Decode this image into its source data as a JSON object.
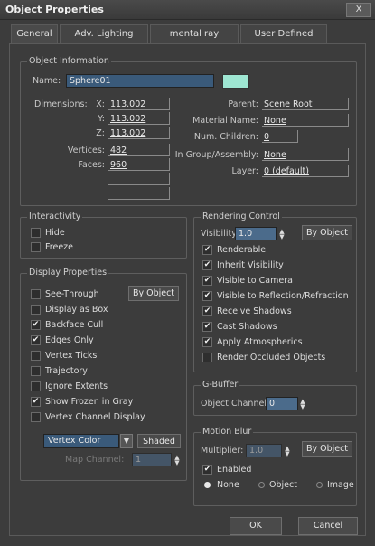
{
  "window": {
    "title": "Object Properties",
    "close": "X"
  },
  "tabs": [
    "General",
    "Adv. Lighting",
    "mental ray",
    "User Defined"
  ],
  "object_info": {
    "group_label": "Object Information",
    "name_label": "Name:",
    "name_value": "Sphere01",
    "swatch_color": "#9ee6d2",
    "dimensions_label": "Dimensions:",
    "x_label": "X:",
    "x_value": "113.002",
    "y_label": "Y:",
    "y_value": "113.002",
    "z_label": "Z:",
    "z_value": "113.002",
    "vertices_label": "Vertices:",
    "vertices_value": "482",
    "faces_label": "Faces:",
    "faces_value": "960",
    "parent_label": "Parent:",
    "parent_value": "Scene Root",
    "material_label": "Material Name:",
    "material_value": "None",
    "children_label": "Num. Children:",
    "children_value": "0",
    "group_assembly_label": "In Group/Assembly:",
    "group_assembly_value": "None",
    "layer_label": "Layer:",
    "layer_value": "0 (default)"
  },
  "interactivity": {
    "label": "Interactivity",
    "items": [
      {
        "label": "Hide",
        "checked": false
      },
      {
        "label": "Freeze",
        "checked": false
      }
    ]
  },
  "display": {
    "label": "Display Properties",
    "by_object": "By Object",
    "items": [
      {
        "label": "See-Through",
        "checked": false
      },
      {
        "label": "Display as Box",
        "checked": false
      },
      {
        "label": "Backface Cull",
        "checked": true
      },
      {
        "label": "Edges Only",
        "checked": true
      },
      {
        "label": "Vertex Ticks",
        "checked": false
      },
      {
        "label": "Trajectory",
        "checked": false
      },
      {
        "label": "Ignore Extents",
        "checked": false
      },
      {
        "label": "Show Frozen in Gray",
        "checked": true
      },
      {
        "label": "Vertex Channel Display",
        "checked": false
      }
    ],
    "vertex_color": "Vertex Color",
    "shaded": "Shaded",
    "map_channel_label": "Map Channel:",
    "map_channel_value": "1"
  },
  "rendering": {
    "label": "Rendering Control",
    "visibility_label": "Visibility:",
    "visibility_value": "1.0",
    "by_object": "By Object",
    "items": [
      {
        "label": "Renderable",
        "checked": true
      },
      {
        "label": "Inherit Visibility",
        "checked": true
      },
      {
        "label": "Visible to Camera",
        "checked": true
      },
      {
        "label": "Visible to Reflection/Refraction",
        "checked": true
      },
      {
        "label": "Receive Shadows",
        "checked": true
      },
      {
        "label": "Cast Shadows",
        "checked": true
      },
      {
        "label": "Apply Atmospherics",
        "checked": true
      },
      {
        "label": "Render Occluded Objects",
        "checked": false
      }
    ]
  },
  "gbuffer": {
    "label": "G-Buffer",
    "channel_label": "Object Channel:",
    "channel_value": "0"
  },
  "motion_blur": {
    "label": "Motion Blur",
    "multiplier_label": "Multiplier:",
    "multiplier_value": "1.0",
    "by_object": "By Object",
    "enabled_label": "Enabled",
    "enabled_checked": true,
    "options": [
      {
        "label": "None",
        "selected": true
      },
      {
        "label": "Object",
        "selected": false
      },
      {
        "label": "Image",
        "selected": false
      }
    ]
  },
  "footer": {
    "ok": "OK",
    "cancel": "Cancel"
  }
}
